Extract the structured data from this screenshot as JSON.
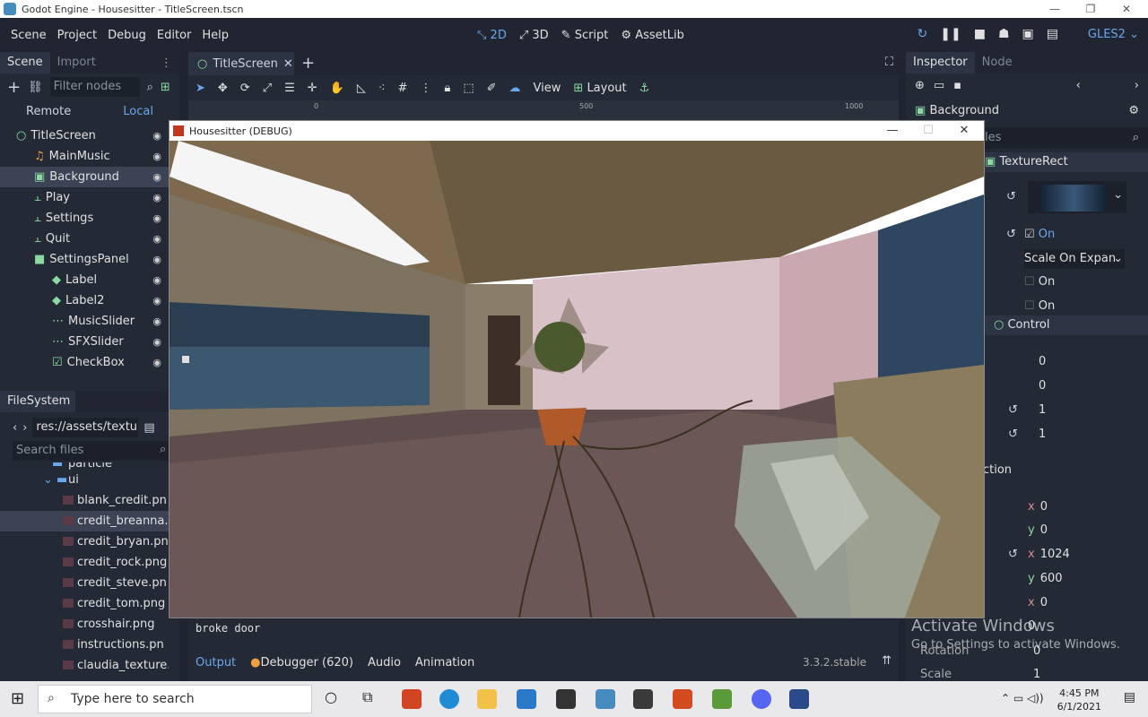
{
  "window_title": "Godot Engine - Housesitter - TitleScreen.tscn",
  "menu": [
    "Scene",
    "Project",
    "Debug",
    "Editor",
    "Help"
  ],
  "workspaces": [
    {
      "label": "2D",
      "icon": "2d-icon"
    },
    {
      "label": "3D",
      "icon": "3d-icon"
    },
    {
      "label": "Script",
      "icon": "script-icon"
    },
    {
      "label": "AssetLib",
      "icon": "assetlib-icon"
    }
  ],
  "renderer": "GLES2",
  "scene_dock": {
    "tabs": [
      "Scene",
      "Import"
    ],
    "filter_placeholder": "Filter nodes",
    "remote": "Remote",
    "local": "Local",
    "nodes": [
      {
        "label": "TitleScreen",
        "indent": 0
      },
      {
        "label": "MainMusic",
        "indent": 1
      },
      {
        "label": "Background",
        "indent": 1
      },
      {
        "label": "Play",
        "indent": 1
      },
      {
        "label": "Settings",
        "indent": 1
      },
      {
        "label": "Quit",
        "indent": 1
      },
      {
        "label": "SettingsPanel",
        "indent": 1
      },
      {
        "label": "Label",
        "indent": 2
      },
      {
        "label": "Label2",
        "indent": 2
      },
      {
        "label": "MusicSlider",
        "indent": 2
      },
      {
        "label": "SFXSlider",
        "indent": 2
      },
      {
        "label": "CheckBox",
        "indent": 2
      }
    ]
  },
  "filesystem": {
    "tab": "FileSystem",
    "path": "res://assets/textur",
    "search_placeholder": "Search files",
    "folders": [
      "particle",
      "ui"
    ],
    "files": [
      "blank_credit.pn",
      "credit_breanna.",
      "credit_bryan.pn",
      "credit_rock.png",
      "credit_steve.pn",
      "credit_tom.png",
      "crosshair.png",
      "instructions.pn",
      "claudia_texture.p"
    ]
  },
  "editor_tab": "TitleScreen",
  "viewport_toolbar": {
    "view": "View",
    "layout": "Layout"
  },
  "ruler": {
    "r0": "0",
    "r1": "500",
    "r2": "1000"
  },
  "output": {
    "lines": [
      "broke door"
    ],
    "tabs": [
      "Output",
      "Debugger (620)",
      "Audio",
      "Animation"
    ],
    "version": "3.3.2.stable"
  },
  "inspector": {
    "tabs": [
      "Inspector",
      "Node"
    ],
    "node": "Background",
    "filter_suffix": "les",
    "class": "TextureRect",
    "expand_on": "On",
    "stretch": "Scale On Expan",
    "flip_h": "On",
    "flip_v": "On",
    "section_control": "Control",
    "anchors": [
      "0",
      "0",
      "1",
      "1"
    ],
    "section_direction": "ction",
    "position": {
      "x": "0",
      "y": "0"
    },
    "size": {
      "x": "1024",
      "y": "600"
    },
    "min_x": "0",
    "rotation_label": "Rotation",
    "rotation_val": "0",
    "scale_label": "Scale",
    "scale_val": "1",
    "watermark_1": "Activate Windows",
    "watermark_2": "Go to Settings to activate Windows."
  },
  "debug_window": {
    "title": "Housesitter (DEBUG)"
  },
  "taskbar": {
    "search": "Type here to search",
    "time": "4:45 PM",
    "date": "6/1/2021"
  }
}
